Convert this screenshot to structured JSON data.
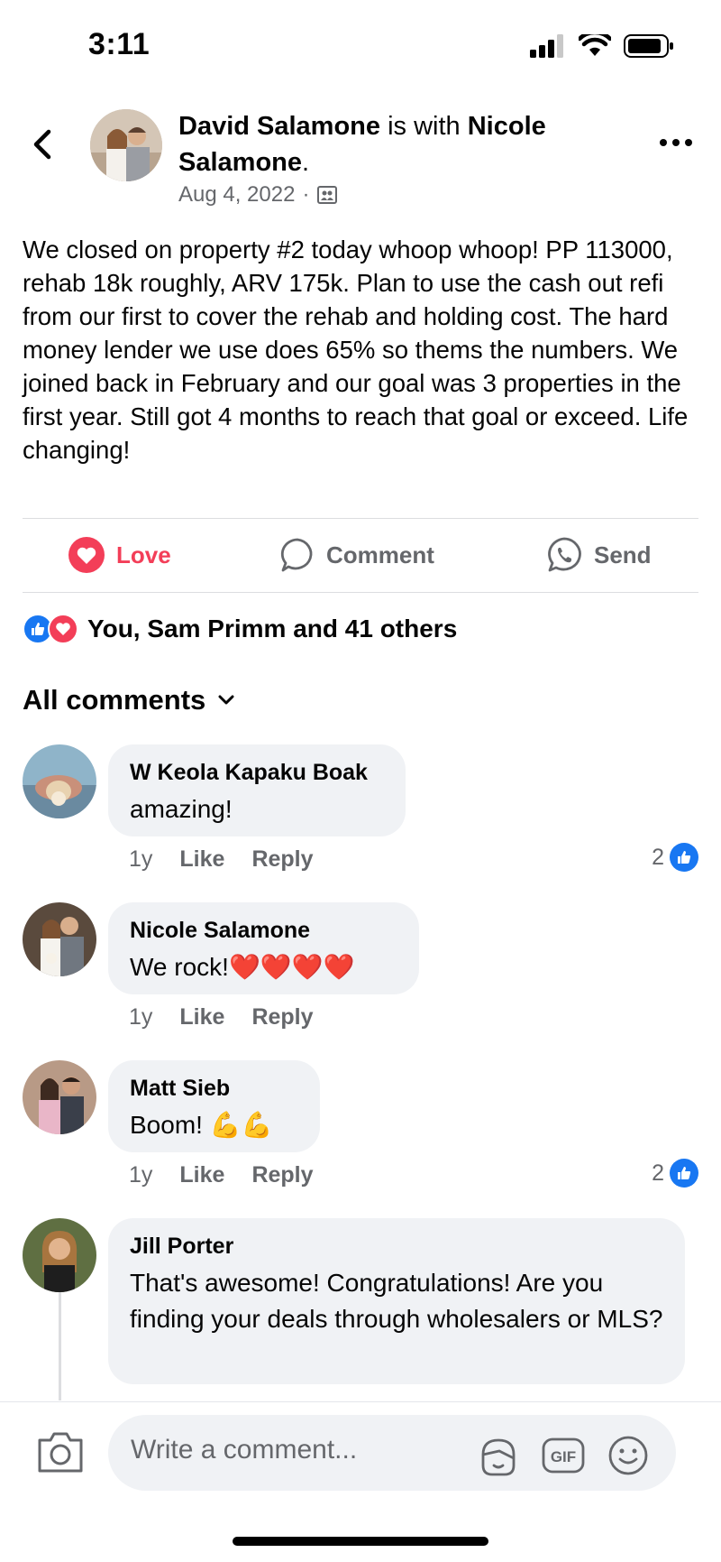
{
  "status_bar": {
    "time": "3:11"
  },
  "post": {
    "author": "David Salamone",
    "with_text": "is with",
    "tagged": "Nicole Salamone",
    "period": ".",
    "date": "Aug 4, 2022",
    "separator": "·",
    "body": "We closed on property #2 today whoop whoop! PP 113000, rehab 18k roughly, ARV 175k. Plan to use the cash out refi from our first to cover the rehab and holding cost. The hard money lender we use does 65% so thems the numbers. We joined back in February and our goal was 3 properties in the first year. Still got 4 months to reach that goal or exceed. Life changing!"
  },
  "actions": {
    "love": "Love",
    "comment": "Comment",
    "send": "Send"
  },
  "reactions": {
    "summary": "You, Sam Primm and 41 others"
  },
  "comments_header": {
    "label": "All comments"
  },
  "comments": [
    {
      "name": "W Keola Kapaku Boak",
      "text": "amazing!",
      "age": "1y",
      "like": "Like",
      "reply": "Reply",
      "likes": "2"
    },
    {
      "name": "Nicole Salamone",
      "text": "We rock!❤️❤️❤️❤️",
      "age": "1y",
      "like": "Like",
      "reply": "Reply",
      "likes": ""
    },
    {
      "name": "Matt Sieb",
      "text": "Boom! 💪💪",
      "age": "1y",
      "like": "Like",
      "reply": "Reply",
      "likes": "2"
    },
    {
      "name": "Jill Porter",
      "text": "That's awesome! Congratulations! Are you finding your deals through wholesalers or MLS?"
    }
  ],
  "composer": {
    "placeholder": "Write a comment..."
  },
  "colors": {
    "love": "#f33e58",
    "like": "#1877f2",
    "muted": "#65676b",
    "bubble": "#f0f2f5"
  }
}
